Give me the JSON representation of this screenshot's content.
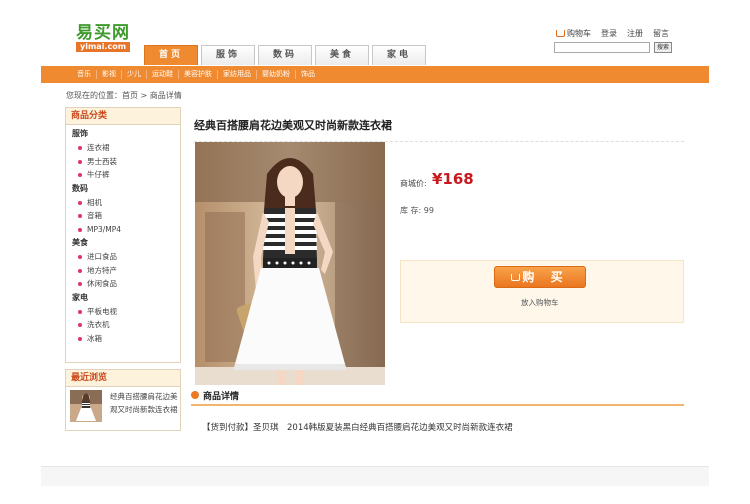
{
  "logo": {
    "name": "易买网",
    "domain": "yimai.com"
  },
  "top_links": [
    "购物车",
    "登录",
    "注册",
    "留言"
  ],
  "search": {
    "button": "搜索",
    "placeholder": ""
  },
  "nav_tabs": [
    "首页",
    "服饰",
    "数码",
    "美食",
    "家电"
  ],
  "active_tab": "首页",
  "sub_nav": [
    "音乐",
    "影视",
    "少儿",
    "运动鞋",
    "美容护肤",
    "家纺用品",
    "婴幼奶粉",
    "饰品"
  ],
  "breadcrumb": "您现在的位置：首页 > 商品详情",
  "categories": {
    "title": "商品分类",
    "groups": [
      {
        "name": "服饰",
        "items": [
          "连衣裙",
          "男士西装",
          "牛仔裤"
        ]
      },
      {
        "name": "数码",
        "items": [
          "相机",
          "音箱",
          "MP3/MP4"
        ]
      },
      {
        "name": "美食",
        "items": [
          "进口食品",
          "地方特产",
          "休闲食品"
        ]
      },
      {
        "name": "家电",
        "items": [
          "平板电视",
          "洗衣机",
          "冰箱"
        ]
      }
    ]
  },
  "recent": {
    "title": "最近浏览",
    "item": "经典百搭腰肩花边美观又时尚新款连衣裙"
  },
  "product": {
    "title": "经典百搭腰肩花边美观又时尚新款连衣裙",
    "price_label": "商城价:",
    "price": "¥168",
    "stock": "库 存: 99",
    "buy_label": "购 买",
    "add_cart": "放入购物车"
  },
  "details": {
    "title": "商品详情",
    "text": "【货到付款】圣贝琪　2014韩版夏装黑白经典百搭腰肩花边美观又时尚新款连衣裙"
  },
  "colors": {
    "accent": "#f08a30",
    "price": "#c8181e",
    "logo": "#3f9a2e"
  }
}
